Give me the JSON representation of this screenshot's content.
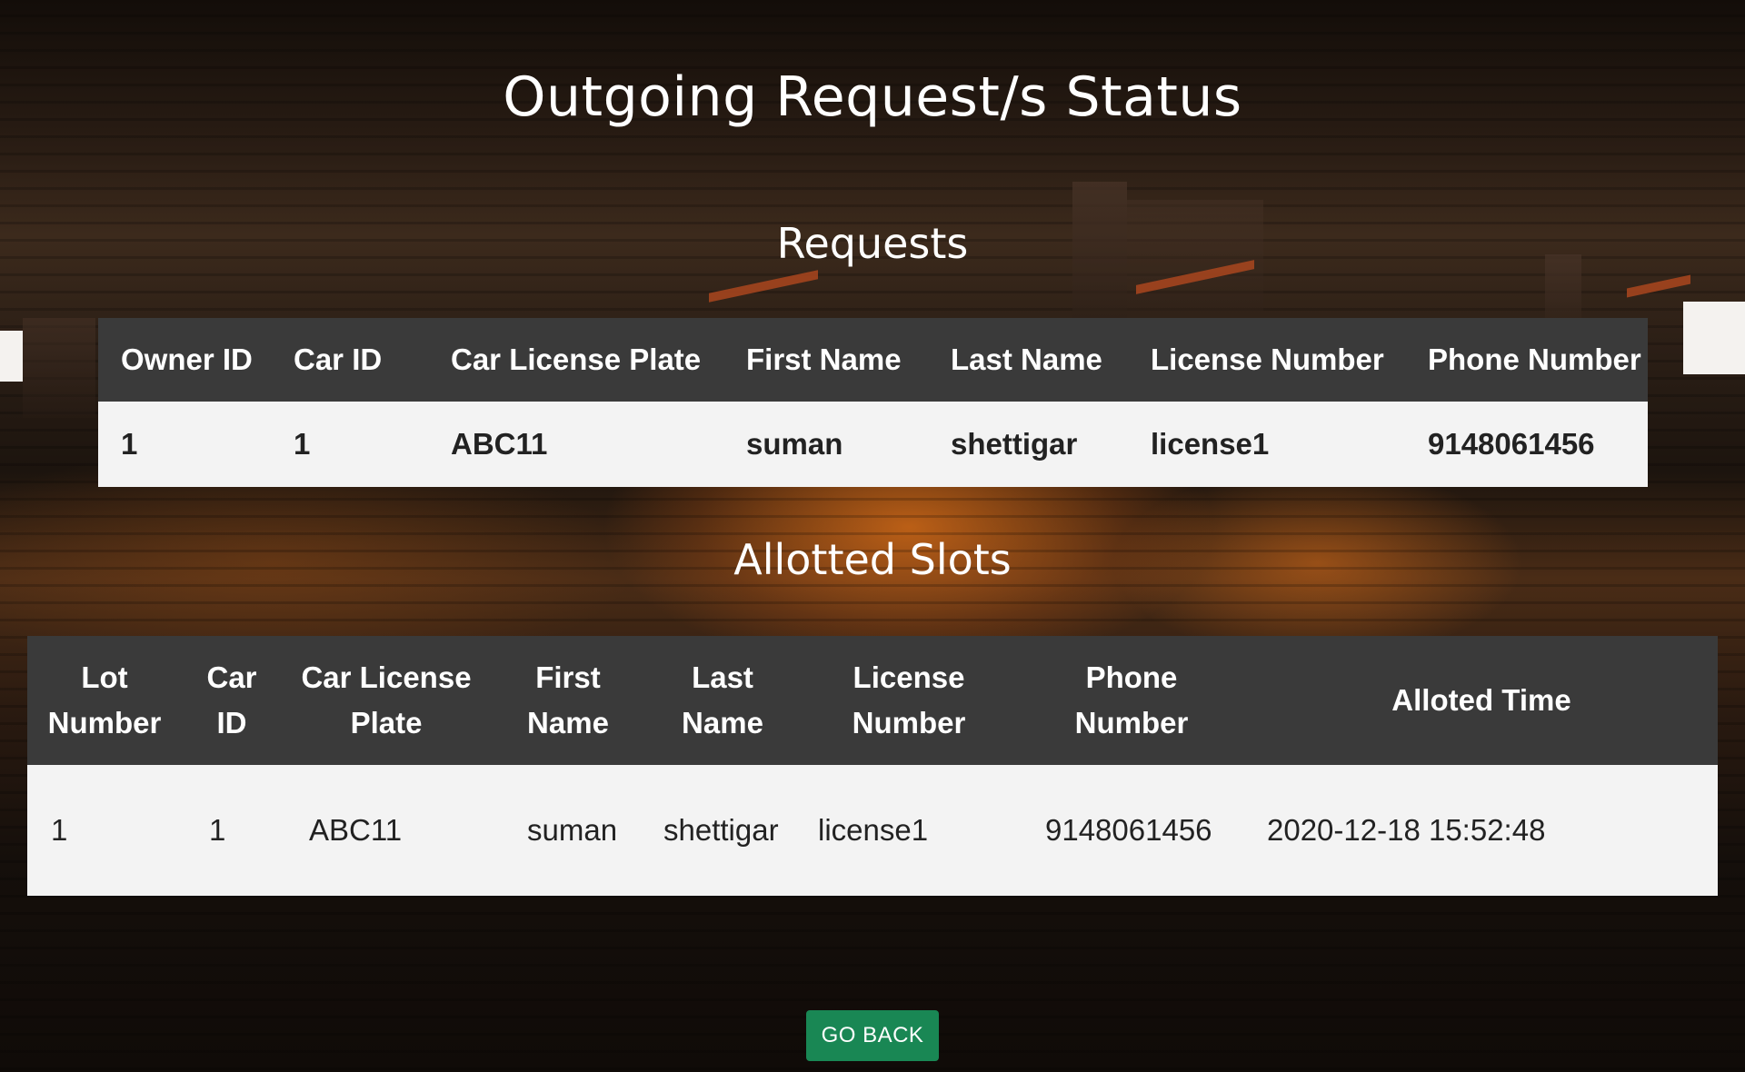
{
  "page": {
    "title": "Outgoing Request/s Status"
  },
  "requests": {
    "title": "Requests",
    "headers": [
      "Owner ID",
      "Car ID",
      "Car License Plate",
      "First Name",
      "Last Name",
      "License Number",
      "Phone Number"
    ],
    "rows": [
      [
        "1",
        "1",
        "ABC11",
        "suman",
        "shettigar",
        "license1",
        "9148061456"
      ]
    ]
  },
  "allotted": {
    "title": "Allotted Slots",
    "headers": [
      "Lot Number",
      "Car ID",
      "Car License Plate",
      "First Name",
      "Last Name",
      "License Number",
      "Phone Number",
      "Alloted Time"
    ],
    "rows": [
      [
        "1",
        "1",
        "ABC11",
        "suman",
        "shettigar",
        "license1",
        "9148061456",
        "2020-12-18 15:52:48"
      ]
    ]
  },
  "actions": {
    "go_back_label": "GO BACK"
  },
  "colors": {
    "header_bg": "#3a3a3a",
    "row_bg": "#f3f3f3",
    "button_bg": "#198754"
  }
}
